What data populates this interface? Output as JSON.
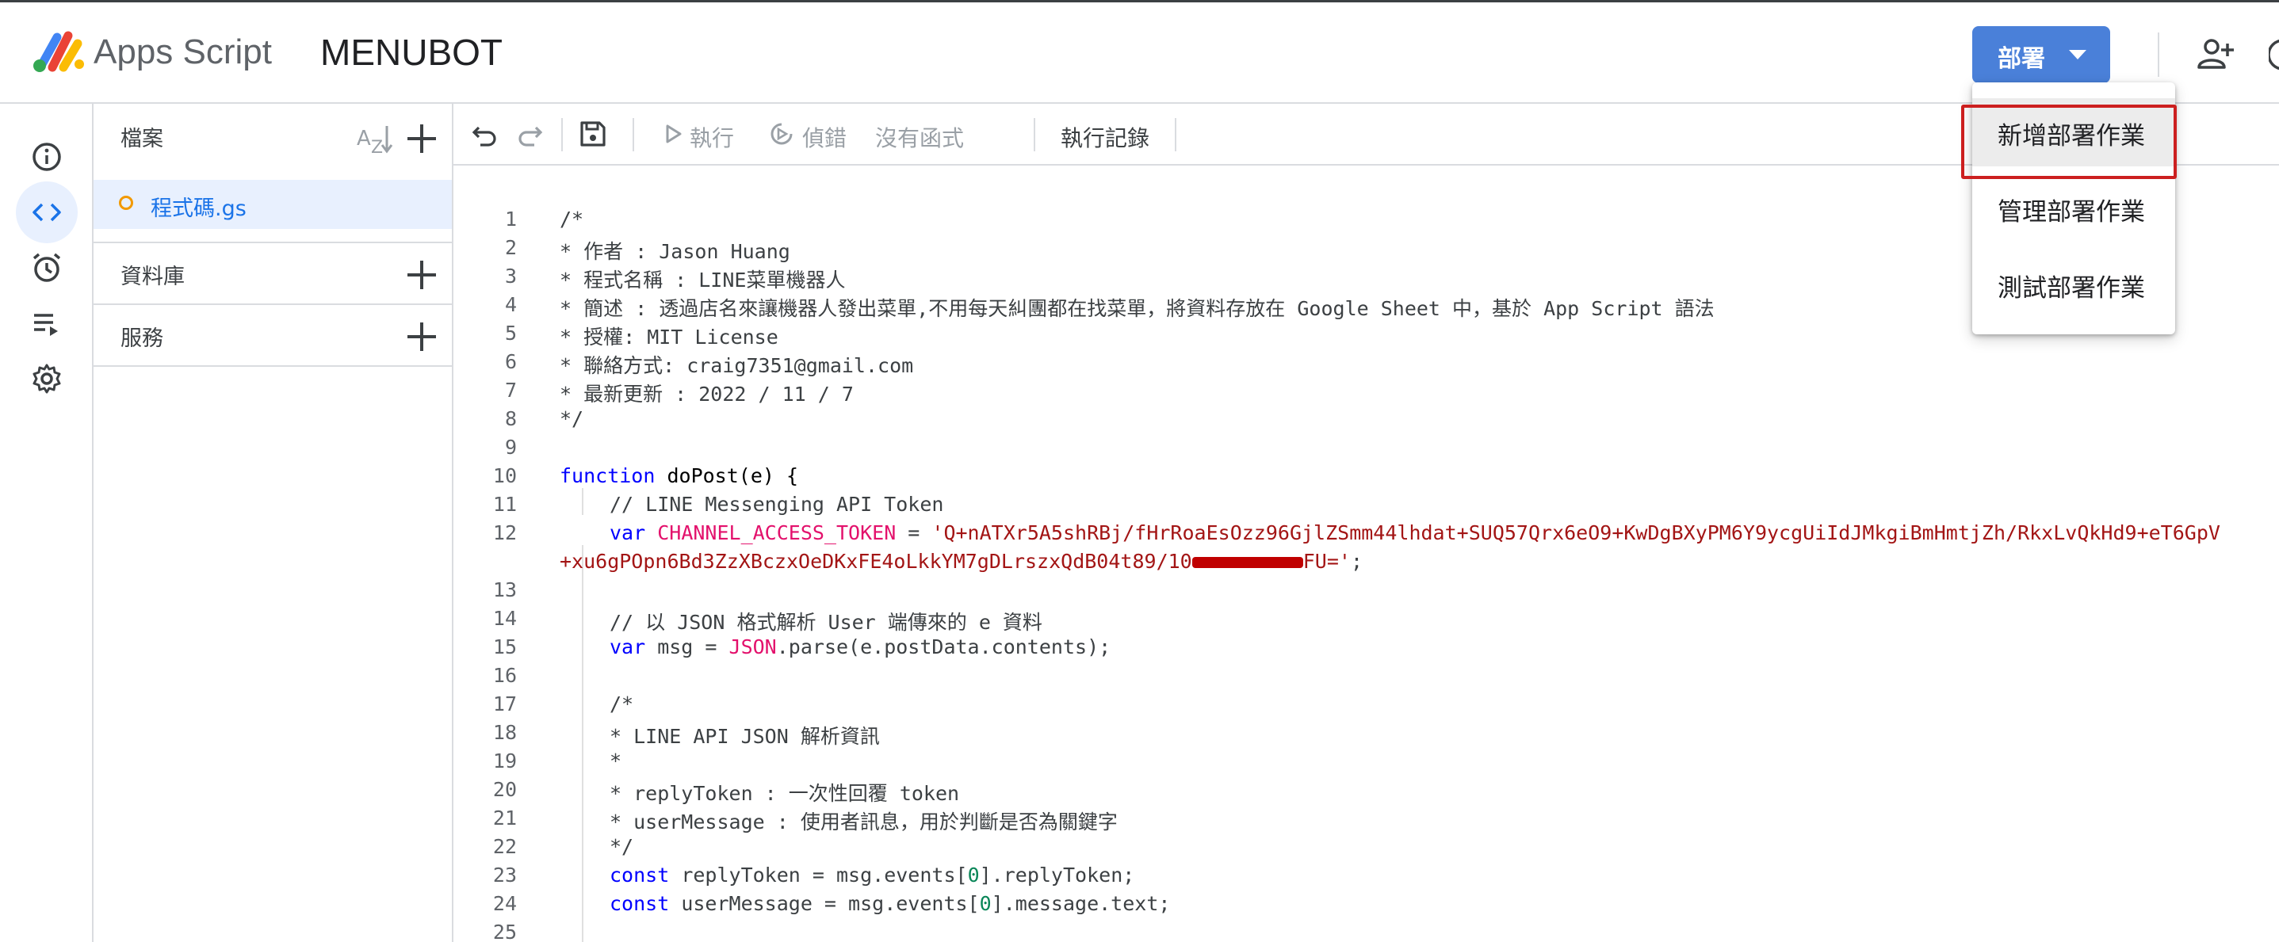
{
  "header": {
    "app_name": "Apps Script",
    "project_name": "MENUBOT",
    "deploy_label": "部署"
  },
  "deploy_menu": {
    "items": [
      "新增部署作業",
      "管理部署作業",
      "測試部署作業"
    ]
  },
  "files_panel": {
    "files_title": "檔案",
    "files": [
      "程式碼.gs"
    ],
    "libraries_title": "資料庫",
    "services_title": "服務"
  },
  "toolbar": {
    "run_label": "執行",
    "debug_label": "偵錯",
    "function_label": "沒有函式",
    "log_label": "執行記錄"
  },
  "code": {
    "line_numbers": [
      "1",
      "2",
      "3",
      "4",
      "5",
      "6",
      "7",
      "8",
      "9",
      "10",
      "11",
      "12",
      "13",
      "14",
      "15",
      "16",
      "17",
      "18",
      "19",
      "20",
      "21",
      "22",
      "23",
      "24",
      "25"
    ],
    "l1": "/*",
    "l2": "* 作者 : Jason Huang",
    "l3": "* 程式名稱 : LINE菜單機器人",
    "l4": "* 簡述 : 透過店名來讓機器人發出菜單,不用每天糾團都在找菜單，將資料存放在 Google Sheet 中，基於 App Script 語法",
    "l5": "* 授權: MIT License",
    "l6": "* 聯絡方式: craig7351@gmail.com",
    "l7": "* 最新更新 : 2022 / 11 / 7",
    "l8": "*/",
    "l10_kw": "function",
    "l10_rest": " doPost(e) {",
    "l11": "// LINE Messenging API Token",
    "l12_kw": "var",
    "l12_var": "CHANNEL_ACCESS_TOKEN",
    "l12_eq": " = ",
    "l12_str": "'Q+nATXr5A5shRBj/fHrRoaEsOzz96GjlZSmm44lhdat+SUQ57Qrx6eO9+KwDgBXyPM6Y9ycgUiIdJMkgiBmHmtjZh/RkxLvQkHd9+eT6GpV",
    "l12b_str1": "+xu6gPOpn6Bd3ZzXBczxOeDKxFE4oLkkYM7gDLrszxQdB04t89/10",
    "l12b_str2": "FU='",
    "l12b_end": ";",
    "l14": "// 以 JSON 格式解析 User 端傳來的 e 資料",
    "l15_kw": "var",
    "l15_a": " msg = ",
    "l15_json": "JSON",
    "l15_b": ".parse(e.postData.contents);",
    "l17": "/*",
    "l18": "* LINE API JSON 解析資訊",
    "l19": "*",
    "l20": "* replyToken : 一次性回覆 token",
    "l21": "* userMessage : 使用者訊息，用於判斷是否為關鍵字",
    "l22": "*/",
    "l23_kw": "const",
    "l23_a": " replyToken = msg.events[",
    "l23_num": "0",
    "l23_b": "].replyToken;",
    "l24_kw": "const",
    "l24_a": " userMessage = msg.events[",
    "l24_num": "0",
    "l24_b": "].message.text;"
  }
}
